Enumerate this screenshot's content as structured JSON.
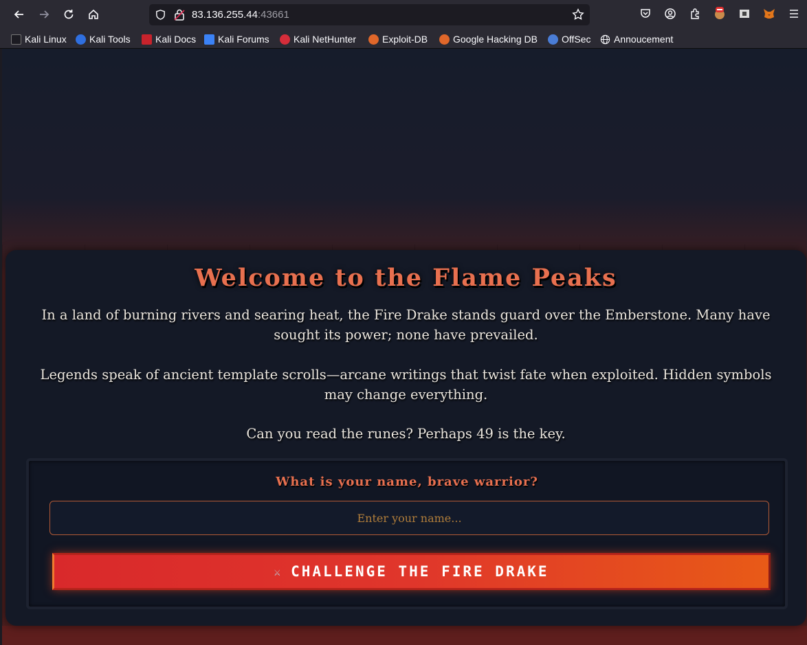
{
  "browser": {
    "url_host": "83.136.255.44",
    "url_port": ":43661"
  },
  "bookmarks": [
    {
      "label": "Kali Linux",
      "icon": "kali-dragon-icon"
    },
    {
      "label": "Kali Tools",
      "icon": "kali-tools-icon"
    },
    {
      "label": "Kali Docs",
      "icon": "kali-docs-icon"
    },
    {
      "label": "Kali Forums",
      "icon": "kali-forums-icon"
    },
    {
      "label": "Kali NetHunter",
      "icon": "nethunter-icon"
    },
    {
      "label": "Exploit-DB",
      "icon": "exploit-db-icon"
    },
    {
      "label": "Google Hacking DB",
      "icon": "ghdb-icon"
    },
    {
      "label": "OffSec",
      "icon": "offsec-icon"
    },
    {
      "label": "Annoucement",
      "icon": "globe-icon"
    }
  ],
  "page": {
    "title": "Welcome to the Flame Peaks",
    "intro": "In a land of burning rivers and searing heat, the Fire Drake stands guard over the Emberstone. Many have sought its power; none have prevailed.",
    "legend": "Legends speak of ancient template scrolls—arcane writings that twist fate when exploited. Hidden symbols may change everything.",
    "hint": "Can you read the runes? Perhaps 49 is the key.",
    "form": {
      "question": "What is your name, brave warrior?",
      "name_placeholder": "Enter your name...",
      "button_label": "CHALLENGE THE FIRE DRAKE",
      "button_icon": "⚔"
    }
  },
  "colors": {
    "accent": "#e8704f",
    "button_start": "#d9292b",
    "button_end": "#e85a17"
  }
}
